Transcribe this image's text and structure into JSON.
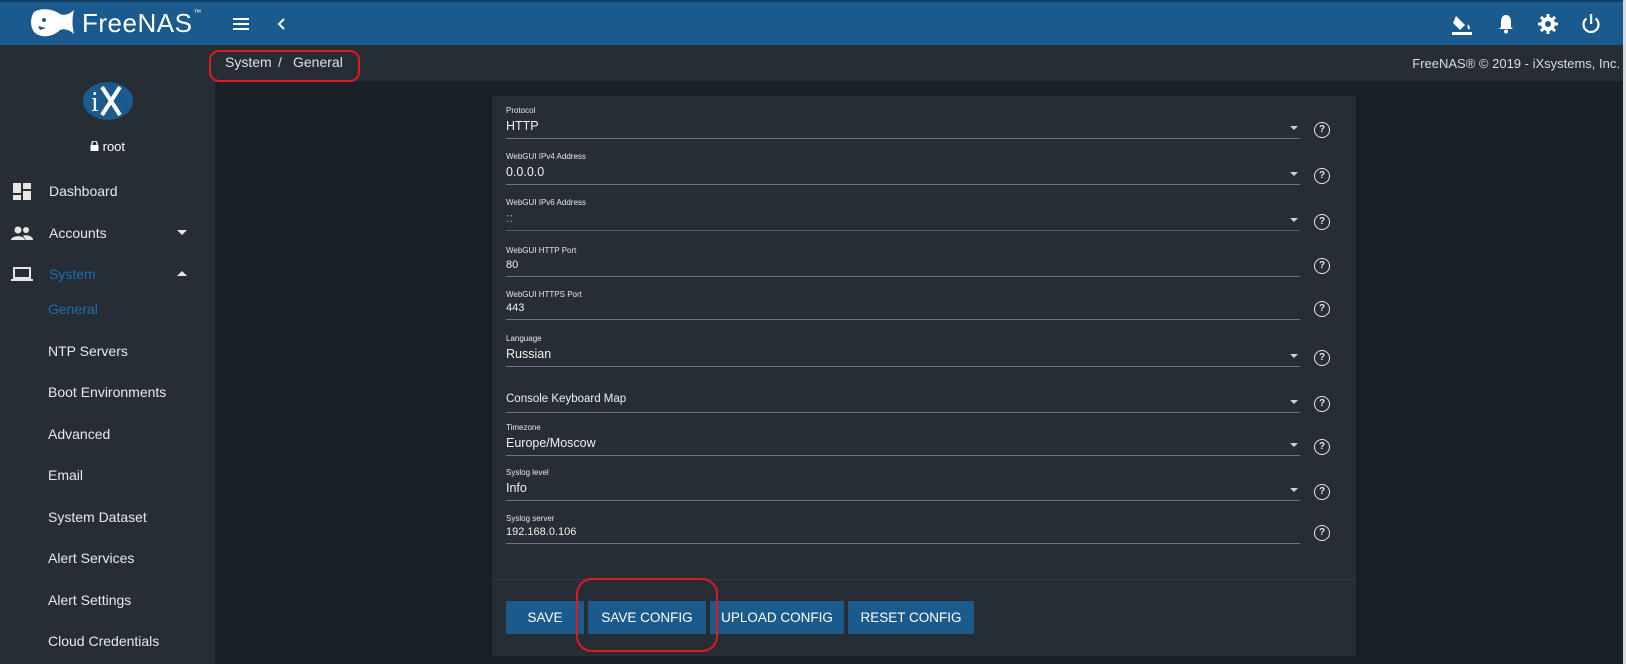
{
  "app": {
    "name": "FreeNAS",
    "trademark": "™"
  },
  "topbar": {
    "icons": [
      "menu-icon",
      "chevron-left-icon",
      "paint-bucket-icon",
      "bell-icon",
      "gear-icon",
      "power-icon"
    ]
  },
  "sidebar": {
    "user": "root",
    "items": [
      {
        "label": "Dashboard",
        "icon": "dashboard-icon"
      },
      {
        "label": "Accounts",
        "icon": "people-icon"
      },
      {
        "label": "System",
        "icon": "laptop-icon"
      }
    ],
    "system_sub": [
      "General",
      "NTP Servers",
      "Boot Environments",
      "Advanced",
      "Email",
      "System Dataset",
      "Alert Services",
      "Alert Settings",
      "Cloud Credentials"
    ]
  },
  "breadcrumb": {
    "first": "System",
    "separator": "/",
    "second": "General"
  },
  "copyright": "FreeNAS® © 2019 - iXsystems, Inc.",
  "form": {
    "fields": [
      {
        "label": "Protocol",
        "value": "HTTP",
        "type": "select"
      },
      {
        "label": "WebGUI IPv4 Address",
        "value": "0.0.0.0",
        "type": "select"
      },
      {
        "label": "WebGUI IPv6 Address",
        "value": "::",
        "type": "select"
      },
      {
        "label": "WebGUI HTTP Port",
        "value": "80",
        "type": "input"
      },
      {
        "label": "WebGUI HTTPS Port",
        "value": "443",
        "type": "input"
      },
      {
        "label": "Language",
        "value": "Russian",
        "type": "select"
      },
      {
        "label": "",
        "value": "Console Keyboard Map",
        "type": "select"
      },
      {
        "label": "Timezone",
        "value": "Europe/Moscow",
        "type": "select"
      },
      {
        "label": "Syslog level",
        "value": "Info",
        "type": "select"
      },
      {
        "label": "Syslog server",
        "value": "192.168.0.106",
        "type": "input"
      }
    ],
    "help_glyph": "?",
    "buttons": {
      "save": "SAVE",
      "save_config": "SAVE CONFIG",
      "upload_config": "UPLOAD CONFIG",
      "reset_config": "RESET CONFIG"
    }
  },
  "colors": {
    "topbar": "#1b5a8c",
    "sidebar": "#262d35",
    "background": "#1a2027",
    "accent_active": "#1d6fad",
    "annotation": "#e0181f"
  }
}
